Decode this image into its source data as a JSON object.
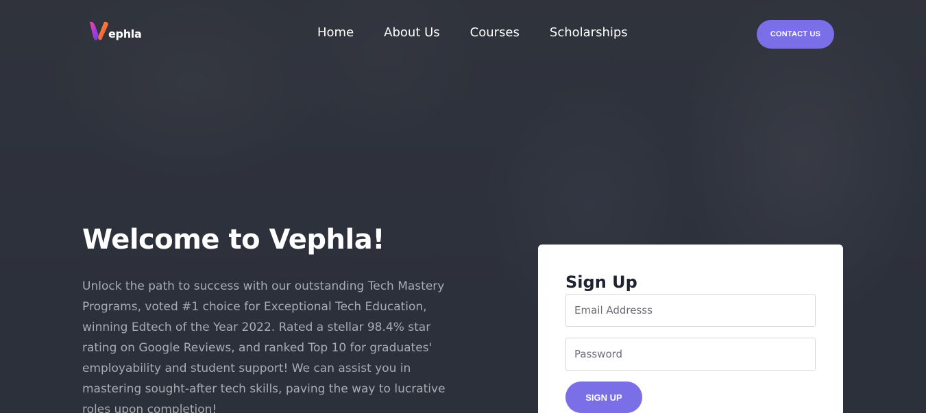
{
  "brand": {
    "logo_text": "ephla",
    "accent_color": "#7b6fe8"
  },
  "nav": {
    "items": [
      {
        "label": "Home"
      },
      {
        "label": "About Us"
      },
      {
        "label": "Courses"
      },
      {
        "label": "Scholarships"
      }
    ],
    "contact_label": "CONTACT US"
  },
  "hero": {
    "title": "Welcome to Vephla!",
    "description": "Unlock the path to success with our outstanding Tech Mastery Programs, voted #1 choice for Exceptional Tech Education, winning Edtech of the Year 2022. Rated a stellar 98.4% star rating on Google Reviews, and ranked Top 10 for graduates' employability and student support! We can assist you in mastering sought-after tech skills, paving the way to lucrative roles upon completion!"
  },
  "signup": {
    "title": "Sign Up",
    "email_placeholder": "Email Addresss",
    "password_placeholder": "Password",
    "button_label": "SIGN UP"
  }
}
